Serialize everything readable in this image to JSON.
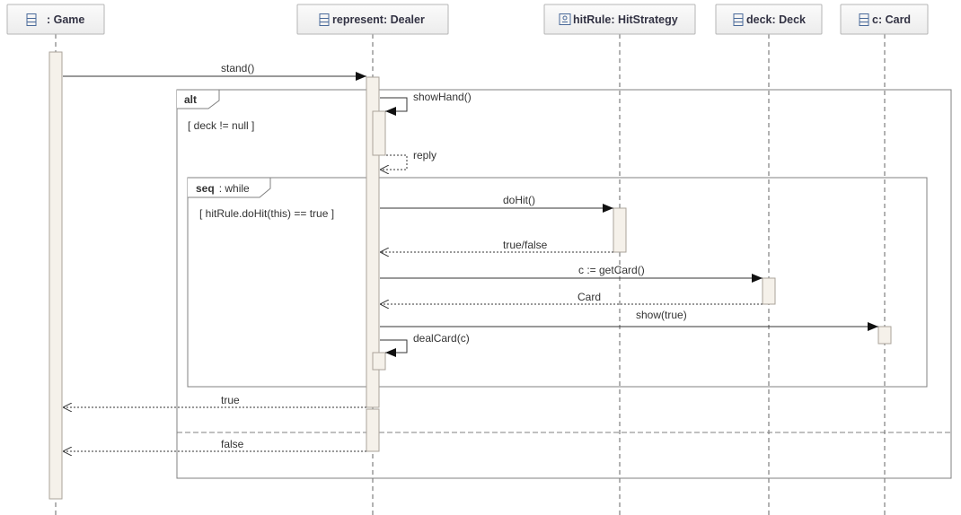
{
  "lifelines": [
    {
      "id": "game",
      "label": ": Game",
      "icon": "class-icon"
    },
    {
      "id": "dealer",
      "label": "represent: Dealer",
      "icon": "class-icon"
    },
    {
      "id": "hitrule",
      "label": "hitRule: HitStrategy",
      "icon": "interface-icon"
    },
    {
      "id": "deck",
      "label": "deck: Deck",
      "icon": "class-icon"
    },
    {
      "id": "card",
      "label": "c: Card",
      "icon": "class-icon"
    }
  ],
  "frames": {
    "alt": {
      "keyword": "alt",
      "guard": "[ deck != null ]"
    },
    "loop": {
      "keyword": "seq",
      "suffix": ": while",
      "guard": "[ hitRule.doHit(this) == true ]"
    }
  },
  "messages": {
    "stand": "stand()",
    "showHand": "showHand()",
    "reply": "reply",
    "doHit": "doHit()",
    "trueFalse": "true/false",
    "getCard": "c := getCard()",
    "cardReturn": "Card",
    "show": "show(true)",
    "dealCard": "dealCard(c)",
    "returnTrue": "true",
    "returnFalse": "false"
  },
  "colors": {
    "header_fill": "#f2f2f2",
    "header_border": "#b5b5b5",
    "activation_fill": "#f5f1ea",
    "activation_border": "#aaa39a",
    "line": "#333333",
    "frame_border": "#808080"
  }
}
